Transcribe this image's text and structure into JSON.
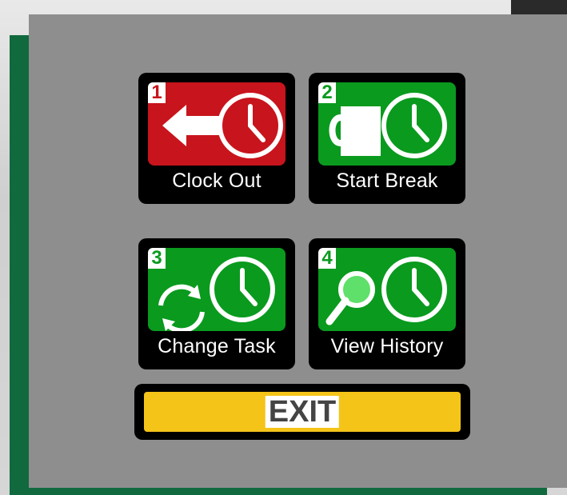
{
  "colors": {
    "clock_out_bg": "#c8141c",
    "action_bg": "#0a9a1e",
    "exit_bg": "#f5c419",
    "panel_bg": "#8e8e8e",
    "frame_green": "#106a3e"
  },
  "tiles": [
    {
      "number": "1",
      "label": "Clock Out",
      "icon": "clock-out-arrow-clock-icon"
    },
    {
      "number": "2",
      "label": "Start Break",
      "icon": "coffee-cup-clock-icon"
    },
    {
      "number": "3",
      "label": "Change Task",
      "icon": "refresh-clock-icon"
    },
    {
      "number": "4",
      "label": "View History",
      "icon": "magnifier-clock-icon"
    }
  ],
  "exit": {
    "label": "EXIT"
  }
}
